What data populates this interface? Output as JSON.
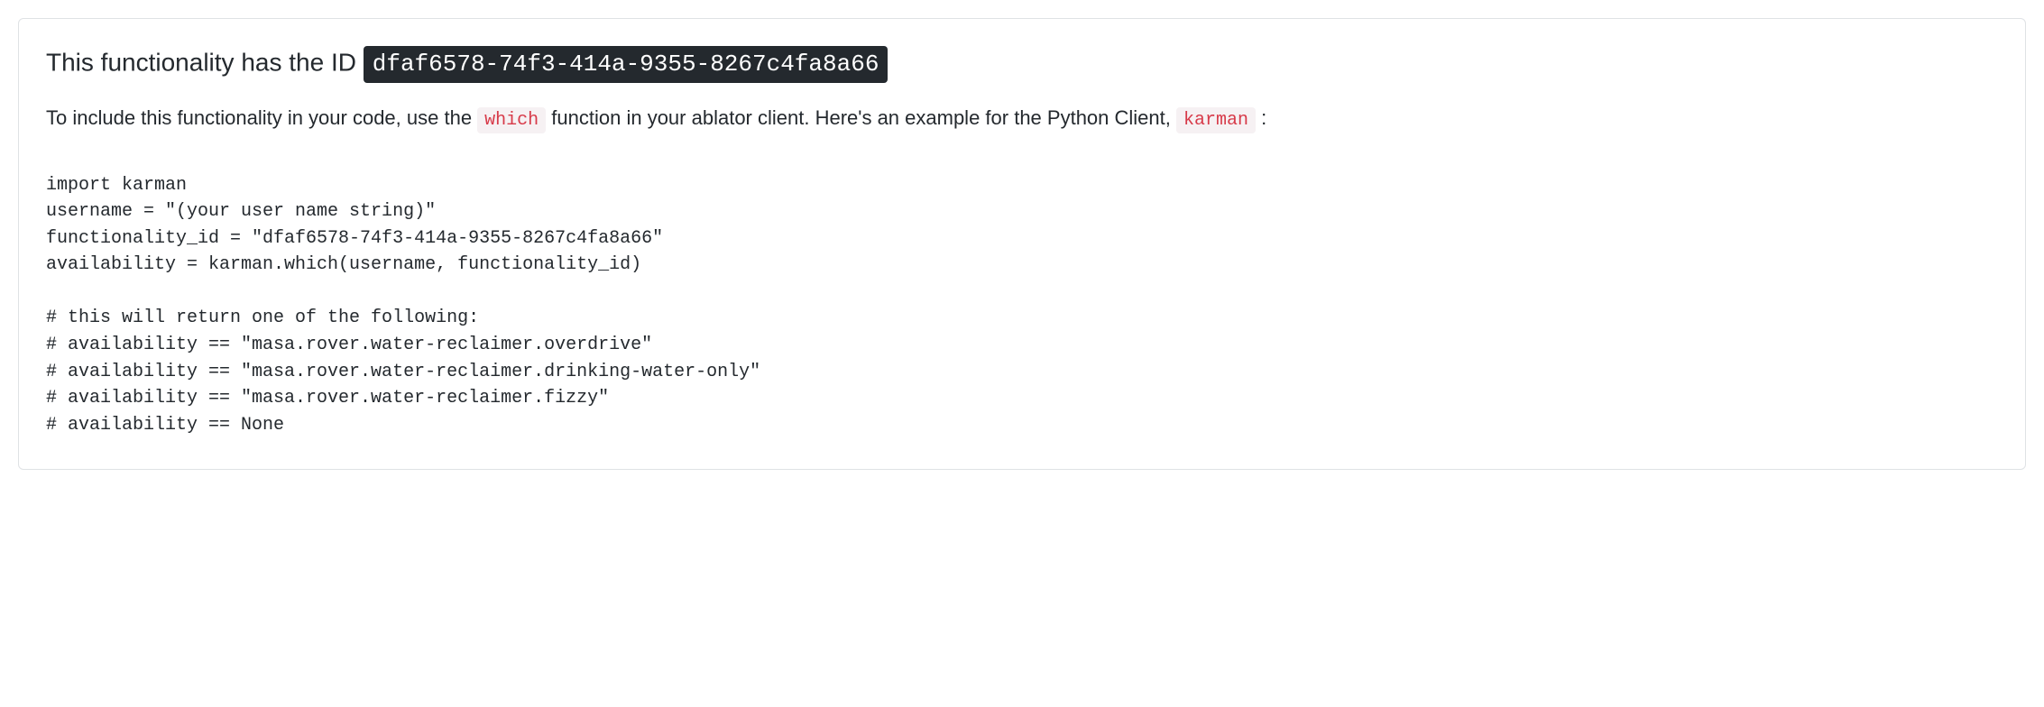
{
  "heading": {
    "prefix": "This functionality has the ID ",
    "id_value": "dfaf6578-74f3-414a-9355-8267c4fa8a66"
  },
  "description": {
    "part1": "To include this functionality in your code, use the ",
    "code1": "which",
    "part2": " function in your ablator client. Here's an example for the Python Client, ",
    "code2": "karman",
    "part3": " :"
  },
  "code_example": "import karman\nusername = \"(your user name string)\"\nfunctionality_id = \"dfaf6578-74f3-414a-9355-8267c4fa8a66\"\navailability = karman.which(username, functionality_id)\n\n# this will return one of the following:\n# availability == \"masa.rover.water-reclaimer.overdrive\"\n# availability == \"masa.rover.water-reclaimer.drinking-water-only\"\n# availability == \"masa.rover.water-reclaimer.fizzy\"\n# availability == None"
}
